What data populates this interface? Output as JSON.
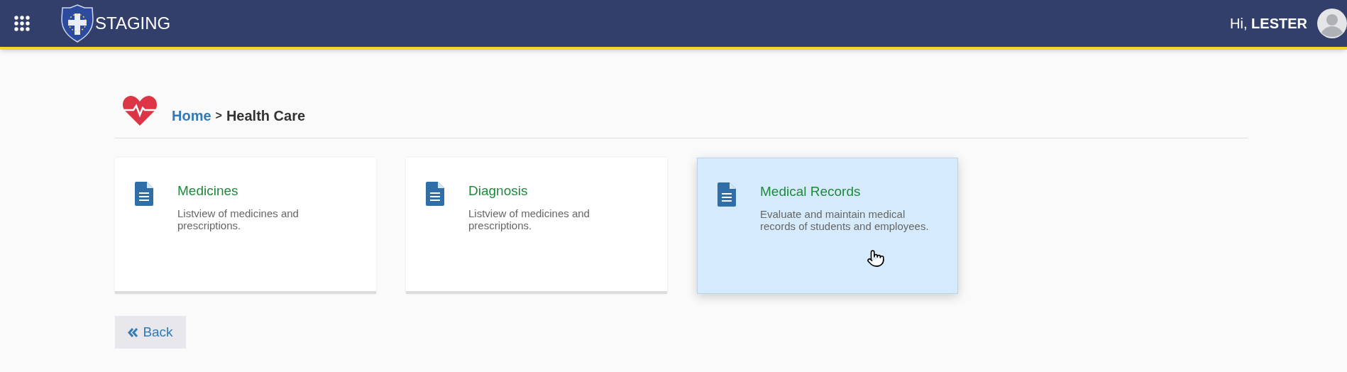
{
  "header": {
    "title": "STAGING",
    "greeting": "Hi, ",
    "user": "LESTER"
  },
  "breadcrumb": {
    "home": "Home",
    "separator": ">",
    "current": "Health Care"
  },
  "cards": [
    {
      "title": "Medicines",
      "description": "Listview of medicines and prescriptions.",
      "highlighted": false
    },
    {
      "title": "Diagnosis",
      "description": "Listview of medicines and prescriptions.",
      "highlighted": false
    },
    {
      "title": "Medical Records",
      "description": "Evaluate and maintain medical records of students and employees.",
      "highlighted": true
    }
  ],
  "back_button": {
    "label": "Back"
  }
}
